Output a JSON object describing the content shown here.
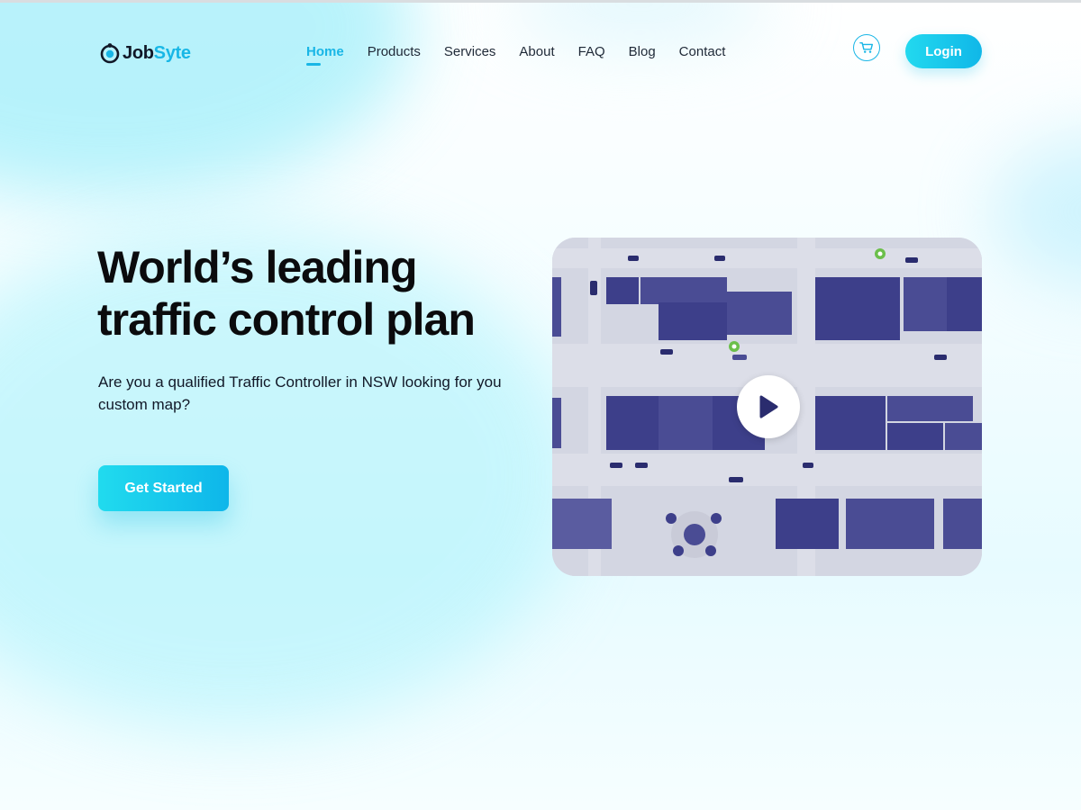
{
  "brand": {
    "name_part1": "Job",
    "name_part2": "Syte",
    "primary_color": "#19b6e6",
    "icon": "logo-icon"
  },
  "nav": {
    "items": [
      {
        "label": "Home",
        "active": true
      },
      {
        "label": "Products",
        "active": false
      },
      {
        "label": "Services",
        "active": false
      },
      {
        "label": "About",
        "active": false
      },
      {
        "label": "FAQ",
        "active": false
      },
      {
        "label": "Blog",
        "active": false
      },
      {
        "label": "Contact",
        "active": false
      }
    ]
  },
  "header": {
    "cart_icon": "cart-icon",
    "login_label": "Login"
  },
  "hero": {
    "title_line1": "World’s leading",
    "title_line2": "traffic control plan",
    "subtitle": "Are you a qualified Traffic Controller in NSW looking for you custom map?",
    "cta_label": "Get Started"
  },
  "video": {
    "play_icon": "play-icon",
    "thumbnail": "aerial-city-map",
    "map_color": "#3d3f8a"
  }
}
